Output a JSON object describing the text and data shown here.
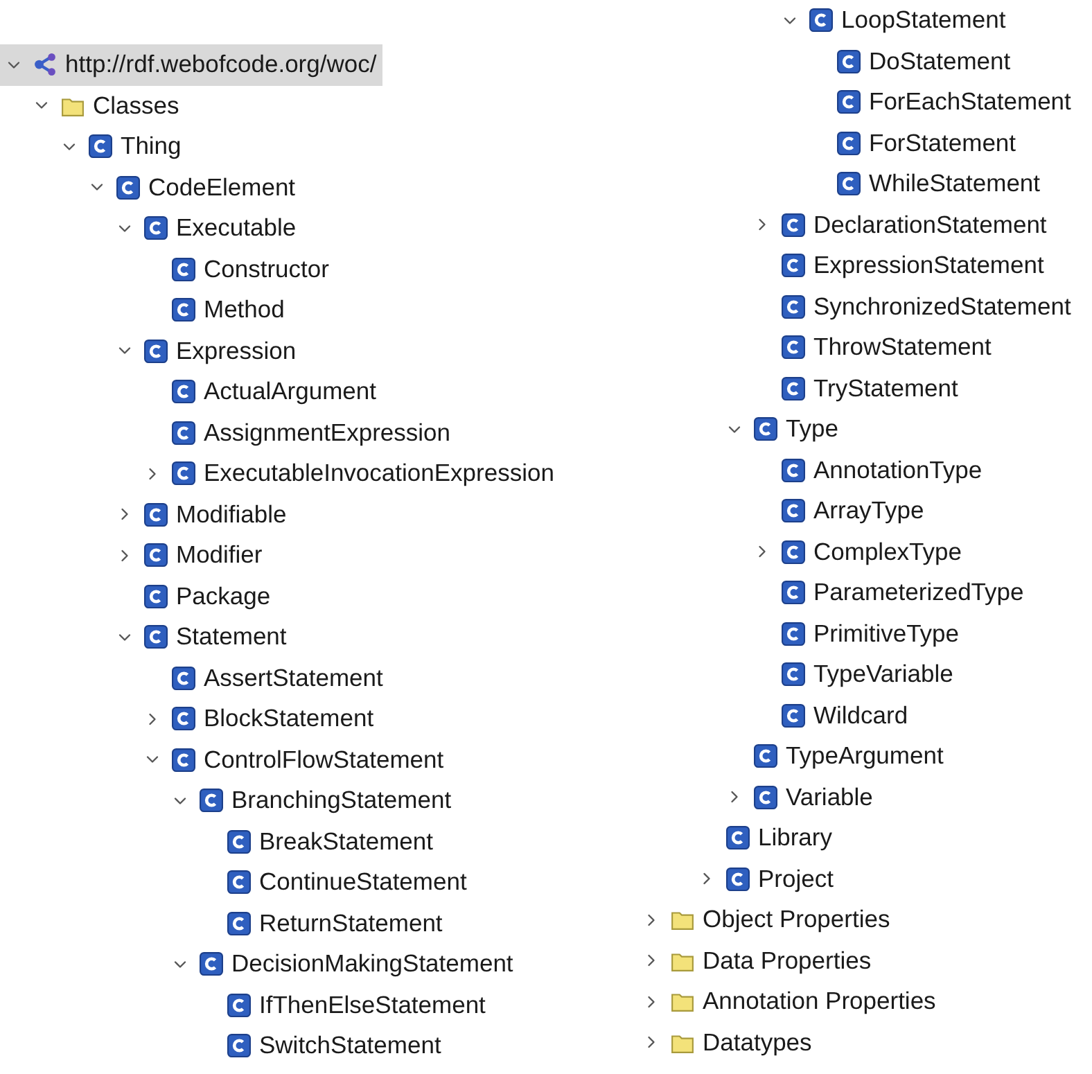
{
  "tree": [
    {
      "label": "http://rdf.webofcode.org/woc/",
      "kind": "ontology",
      "selected": true,
      "expanded": true,
      "children": [
        {
          "label": "Classes",
          "kind": "folder",
          "selected": false,
          "expanded": true,
          "children": [
            {
              "label": "Thing",
              "kind": "class",
              "selected": false,
              "expanded": true,
              "children": [
                {
                  "label": "CodeElement",
                  "kind": "class",
                  "selected": false,
                  "expanded": true,
                  "children": [
                    {
                      "label": "Executable",
                      "kind": "class",
                      "selected": false,
                      "expanded": true,
                      "children": [
                        {
                          "label": "Constructor",
                          "kind": "class",
                          "selected": false
                        },
                        {
                          "label": "Method",
                          "kind": "class",
                          "selected": false
                        }
                      ]
                    },
                    {
                      "label": "Expression",
                      "kind": "class",
                      "selected": false,
                      "expanded": true,
                      "children": [
                        {
                          "label": "ActualArgument",
                          "kind": "class",
                          "selected": false
                        },
                        {
                          "label": "AssignmentExpression",
                          "kind": "class",
                          "selected": false
                        },
                        {
                          "label": "ExecutableInvocationExpression",
                          "kind": "class",
                          "selected": false,
                          "expanded": false
                        }
                      ]
                    },
                    {
                      "label": "Modifiable",
                      "kind": "class",
                      "selected": false,
                      "expanded": false
                    },
                    {
                      "label": "Modifier",
                      "kind": "class",
                      "selected": false,
                      "expanded": false
                    },
                    {
                      "label": "Package",
                      "kind": "class",
                      "selected": false
                    },
                    {
                      "label": "Statement",
                      "kind": "class",
                      "selected": false,
                      "expanded": true,
                      "children": [
                        {
                          "label": "AssertStatement",
                          "kind": "class",
                          "selected": false
                        },
                        {
                          "label": "BlockStatement",
                          "kind": "class",
                          "selected": false,
                          "expanded": false
                        },
                        {
                          "label": "ControlFlowStatement",
                          "kind": "class",
                          "selected": false,
                          "expanded": true,
                          "children": [
                            {
                              "label": "BranchingStatement",
                              "kind": "class",
                              "selected": false,
                              "expanded": true,
                              "children": [
                                {
                                  "label": "BreakStatement",
                                  "kind": "class",
                                  "selected": false
                                },
                                {
                                  "label": "ContinueStatement",
                                  "kind": "class",
                                  "selected": false
                                },
                                {
                                  "label": "ReturnStatement",
                                  "kind": "class",
                                  "selected": false
                                }
                              ]
                            },
                            {
                              "label": "DecisionMakingStatement",
                              "kind": "class",
                              "selected": false,
                              "expanded": true,
                              "children": [
                                {
                                  "label": "IfThenElseStatement",
                                  "kind": "class",
                                  "selected": false
                                },
                                {
                                  "label": "SwitchStatement",
                                  "kind": "class",
                                  "selected": false
                                }
                              ]
                            },
                            {
                              "label": "LoopStatement",
                              "kind": "class",
                              "selected": false,
                              "expanded": true,
                              "children": [
                                {
                                  "label": "DoStatement",
                                  "kind": "class",
                                  "selected": false
                                },
                                {
                                  "label": "ForEachStatement",
                                  "kind": "class",
                                  "selected": false
                                },
                                {
                                  "label": "ForStatement",
                                  "kind": "class",
                                  "selected": false
                                },
                                {
                                  "label": "WhileStatement",
                                  "kind": "class",
                                  "selected": false
                                }
                              ]
                            }
                          ]
                        },
                        {
                          "label": "DeclarationStatement",
                          "kind": "class",
                          "selected": false,
                          "expanded": false
                        },
                        {
                          "label": "ExpressionStatement",
                          "kind": "class",
                          "selected": false
                        },
                        {
                          "label": "SynchronizedStatement",
                          "kind": "class",
                          "selected": false
                        },
                        {
                          "label": "ThrowStatement",
                          "kind": "class",
                          "selected": false
                        },
                        {
                          "label": "TryStatement",
                          "kind": "class",
                          "selected": false
                        }
                      ]
                    },
                    {
                      "label": "Type",
                      "kind": "class",
                      "selected": false,
                      "expanded": true,
                      "children": [
                        {
                          "label": "AnnotationType",
                          "kind": "class",
                          "selected": false
                        },
                        {
                          "label": "ArrayType",
                          "kind": "class",
                          "selected": false
                        },
                        {
                          "label": "ComplexType",
                          "kind": "class",
                          "selected": false,
                          "expanded": false
                        },
                        {
                          "label": "ParameterizedType",
                          "kind": "class",
                          "selected": false
                        },
                        {
                          "label": "PrimitiveType",
                          "kind": "class",
                          "selected": false
                        },
                        {
                          "label": "TypeVariable",
                          "kind": "class",
                          "selected": false
                        },
                        {
                          "label": "Wildcard",
                          "kind": "class",
                          "selected": false
                        }
                      ]
                    },
                    {
                      "label": "TypeArgument",
                      "kind": "class",
                      "selected": false
                    },
                    {
                      "label": "Variable",
                      "kind": "class",
                      "selected": false,
                      "expanded": false
                    }
                  ]
                },
                {
                  "label": "Library",
                  "kind": "class",
                  "selected": false
                },
                {
                  "label": "Project",
                  "kind": "class",
                  "selected": false,
                  "expanded": false
                }
              ]
            }
          ]
        },
        {
          "label": "Object Properties",
          "kind": "folder",
          "selected": false,
          "expanded": false
        },
        {
          "label": "Data Properties",
          "kind": "folder",
          "selected": false,
          "expanded": false
        },
        {
          "label": "Annotation Properties",
          "kind": "folder",
          "selected": false,
          "expanded": false
        },
        {
          "label": "Datatypes",
          "kind": "folder",
          "selected": false,
          "expanded": false
        }
      ]
    }
  ]
}
